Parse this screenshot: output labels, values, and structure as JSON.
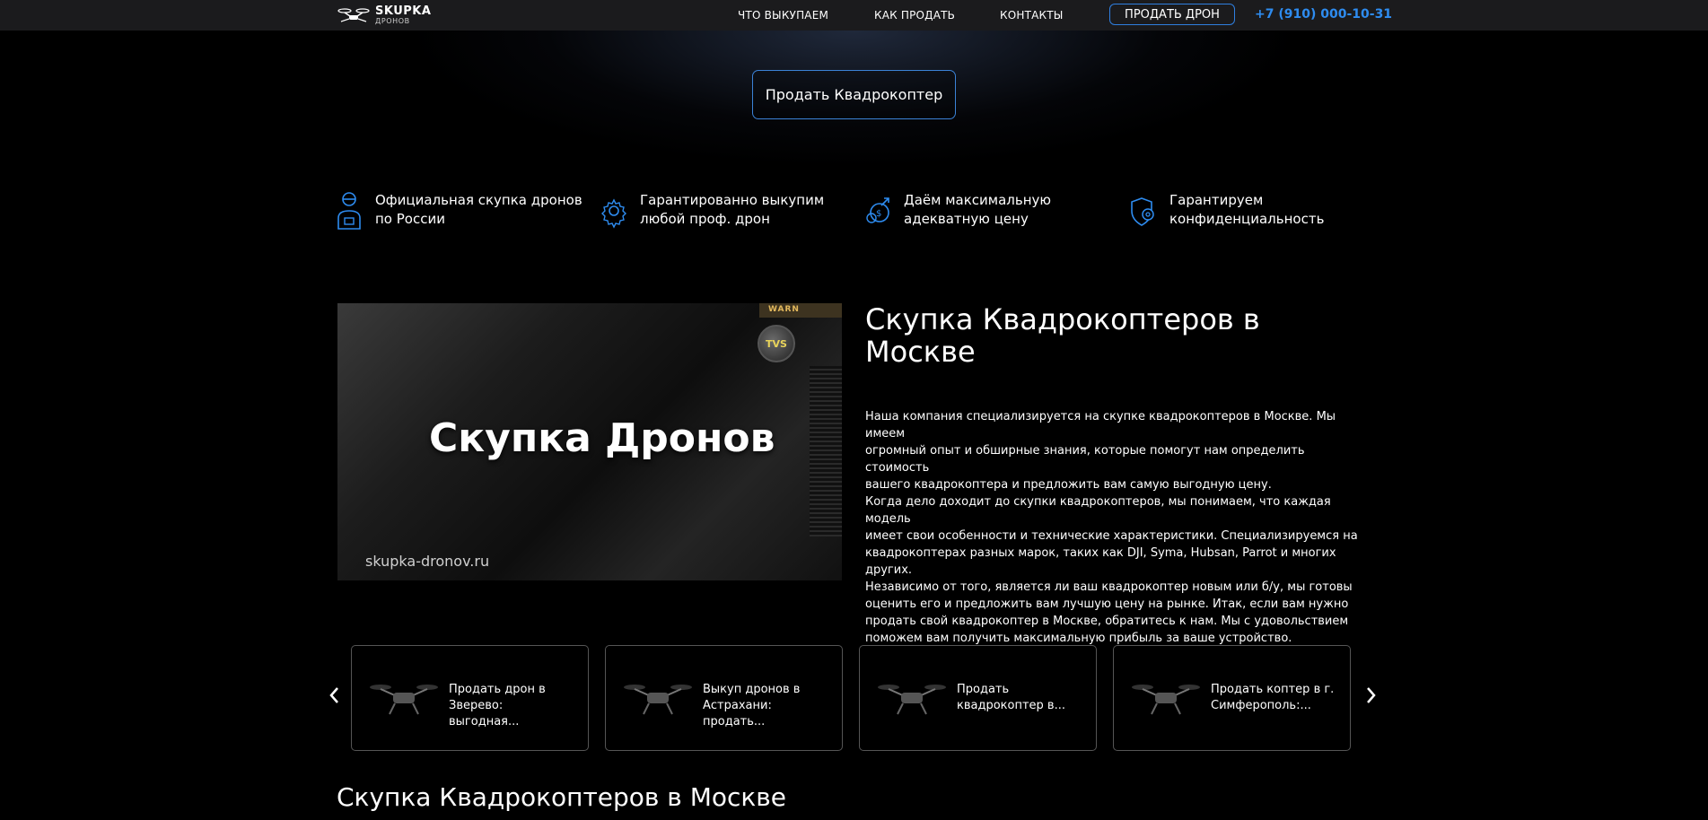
{
  "header": {
    "logo_main": "SKUPKA",
    "logo_sub": "ДРОНОВ",
    "nav": [
      "ЧТО ВЫКУПАЕМ",
      "КАК ПРОДАТЬ",
      "КОНТАКТЫ"
    ],
    "sell_button": "ПРОДАТЬ ДРОН",
    "phone": "+7 (910) 000-10-31"
  },
  "hero": {
    "button_label": "Продать Квадрокоптер"
  },
  "features": [
    {
      "icon": "operator-icon",
      "line1": "Официальная скупка дронов",
      "line2": "по России"
    },
    {
      "icon": "gear-icon",
      "line1": "Гарантированно выкупим",
      "line2": "любой проф. дрон"
    },
    {
      "icon": "money-icon",
      "line1": "Даём максимальную",
      "line2": "адекватную цену"
    },
    {
      "icon": "shield-gear-icon",
      "line1": "Гарантируем",
      "line2": "конфиденциальность"
    }
  ],
  "video": {
    "title": "Скупка Дронов",
    "url": "skupka-dronov.ru",
    "badge": "TVS",
    "warning": "WARN"
  },
  "article": {
    "title": "Скупка Квадрокоптеров в Москве",
    "lines": [
      "Наша компания специализируется на скупке квадрокоптеров в Москве. Мы имеем",
      "огромный опыт и обширные знания, которые помогут нам определить стоимость",
      "вашего квадрокоптера и предложить вам самую выгодную цену.",
      "Когда дело доходит до скупки квадрокоптеров, мы понимаем, что каждая модель",
      "имеет свои особенности и технические характеристики. Специализируемся на",
      "квадрокоптерах разных марок, таких как DJI, Syma, Hubsan, Parrot и многих других.",
      "Независимо от того, является ли ваш квадрокоптер новым или б/у, мы готовы",
      "оценить его и предложить вам лучшую цену на рынке. Итак, если вам нужно",
      "продать свой квадрокоптер в Москве, обратитесь к нам. Мы с удовольствием",
      "поможем вам получить максимальную прибыль за ваше устройство."
    ]
  },
  "carousel": {
    "cards": [
      {
        "line1": "Продать дрон в",
        "line2": "Зверево: выгодная..."
      },
      {
        "line1": "Выкуп дронов в",
        "line2": "Астрахани: продать..."
      },
      {
        "line1": "Продать",
        "line2": "квадрокоптер в..."
      },
      {
        "line1": "Продать коптер в г.",
        "line2": "Симферополь:..."
      }
    ],
    "prev_icon": "chevron-left-icon",
    "next_icon": "chevron-right-icon"
  },
  "section2": {
    "title": "Скупка Квадрокоптеров в Москве"
  },
  "colors": {
    "accent": "#2e8cf0",
    "header_bg": "#1b1b1d",
    "page_bg": "#000000"
  }
}
